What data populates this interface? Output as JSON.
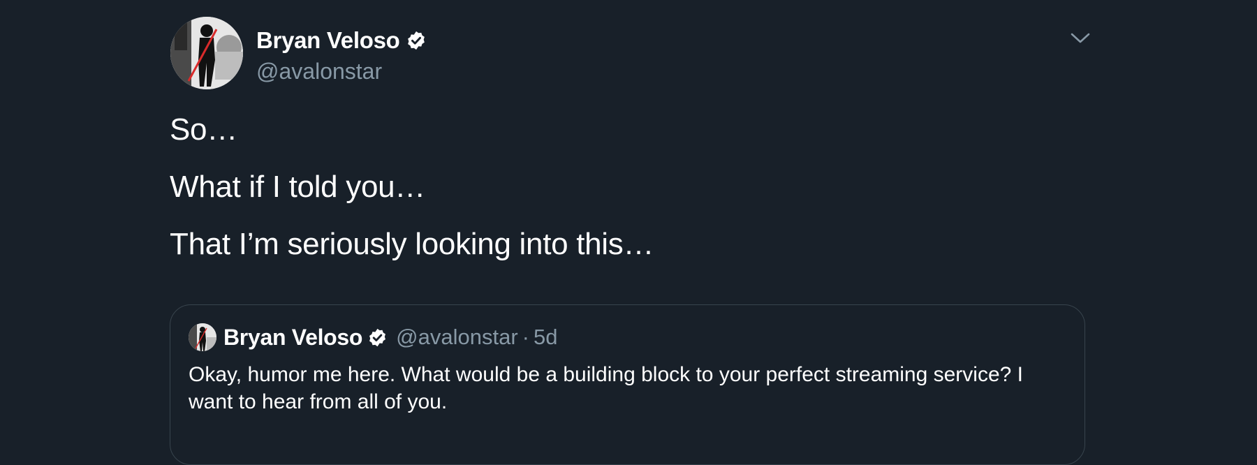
{
  "tweet": {
    "author": {
      "display_name": "Bryan Veloso",
      "handle": "@avalonstar",
      "verified": true,
      "avatar_icon": "profile-photo"
    },
    "menu_icon": "chevron-down-icon",
    "lines": [
      "So…",
      "What if I told you…",
      "That I’m seriously looking into this…"
    ],
    "quoted": {
      "display_name": "Bryan Veloso",
      "handle": "@avalonstar",
      "separator": "·",
      "time": "5d",
      "verified": true,
      "text": "Okay, humor me here. What would be a building block to your perfect streaming service? I want to hear from all of you."
    }
  },
  "colors": {
    "background": "#182029",
    "text": "#ffffff",
    "secondary_text": "#8899a6",
    "border": "#38444d"
  }
}
